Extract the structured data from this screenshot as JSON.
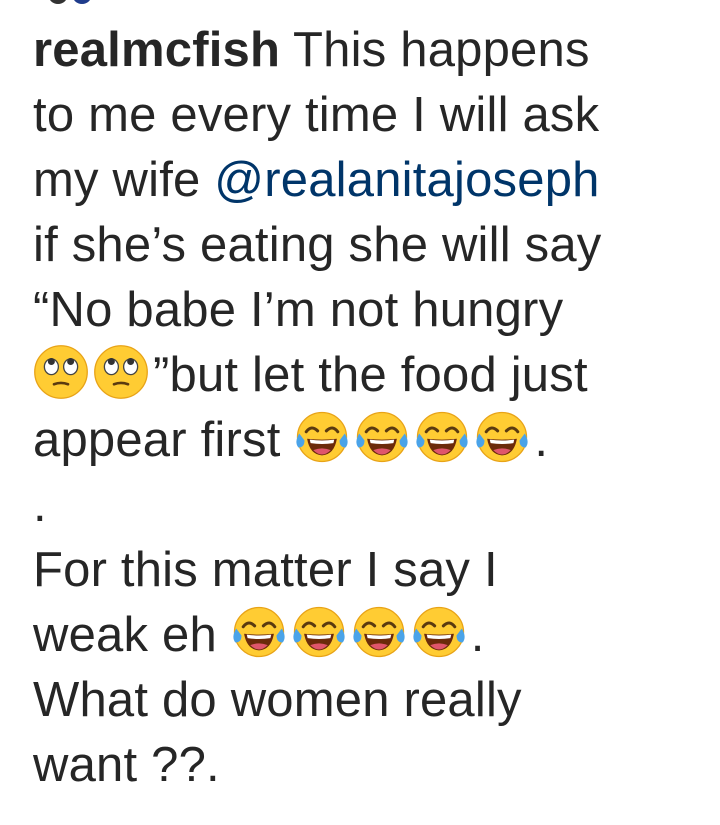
{
  "post": {
    "username": "realmcfish",
    "caption": {
      "part1": " This happens",
      "line2": "to me every time I will ask",
      "line3_prefix": "my wife ",
      "mention": "@realanitajoseph",
      "line4": "if she’s eating she will say",
      "line5": "“No babe I’m not hungry",
      "line6_suffix": "”but let the food just",
      "line7_prefix": "appear first ",
      "line7_suffix": ".",
      "line8": ".",
      "line9": "For this matter I say I",
      "line10_prefix": "weak eh ",
      "line10_suffix": ".",
      "line11": "What do women really",
      "line12": "want ??."
    },
    "emojis": {
      "eye_roll": "face-with-rolling-eyes",
      "laughing": "face-with-tears-of-joy"
    }
  },
  "colors": {
    "text": "#262626",
    "mention": "#003569",
    "emoji_face": "#FFCC33"
  }
}
